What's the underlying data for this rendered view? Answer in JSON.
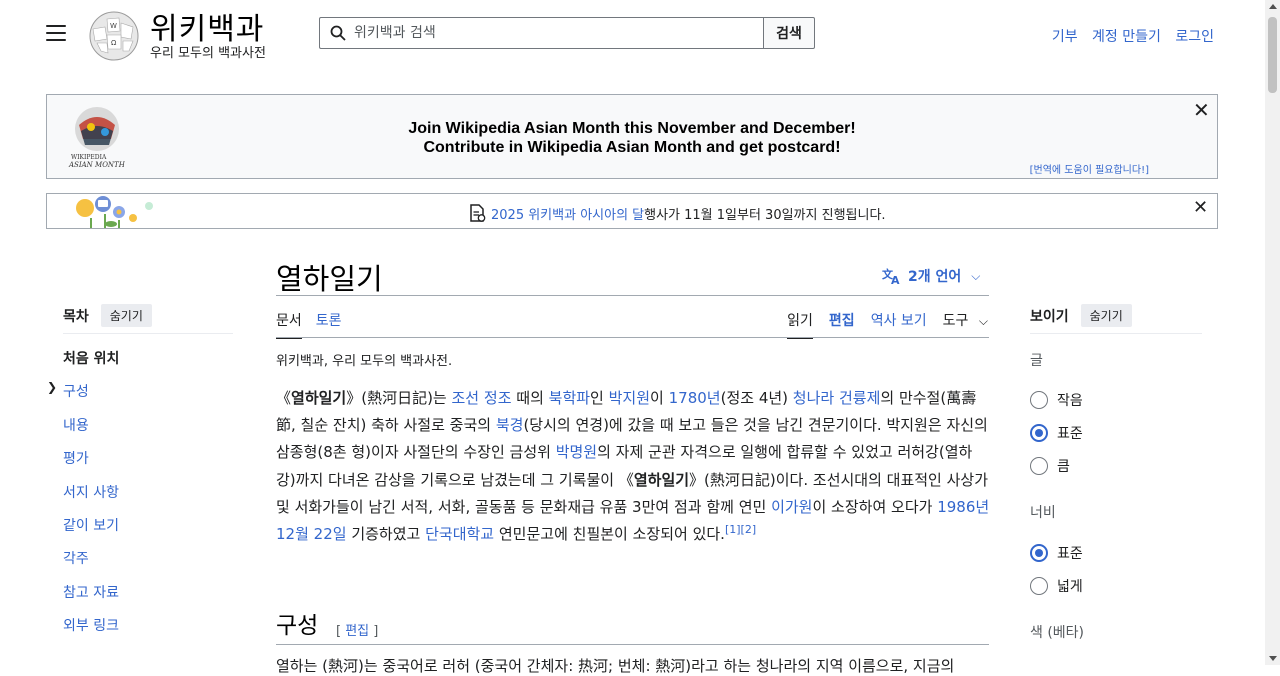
{
  "header": {
    "wordmark": "위키백과",
    "tagline": "우리 모두의 백과사전",
    "search_placeholder": "위키백과 검색",
    "search_button": "검색",
    "links": [
      "기부",
      "계정 만들기",
      "로그인"
    ]
  },
  "banner1": {
    "line1": "Join Wikipedia Asian Month this November and December!",
    "line2": "Contribute in Wikipedia Asian Month and get postcard!",
    "help": "[번역에 도움이 필요합니다!]"
  },
  "banner2": {
    "link": "2025 위키백과 아시아의 달",
    "text": " 행사가 11월 1일부터 30일까지 진행됩니다."
  },
  "toc": {
    "title": "목차",
    "hide": "숨기기",
    "items": [
      "처음 위치",
      "구성",
      "내용",
      "평가",
      "서지 사항",
      "같이 보기",
      "각주",
      "참고 자료",
      "외부 링크"
    ]
  },
  "article": {
    "title": "열하일기",
    "languages": "2개 언어",
    "tabs_left": [
      "문서",
      "토론"
    ],
    "tabs_right": [
      "읽기",
      "편집",
      "역사 보기",
      "도구"
    ],
    "sitesub": "위키백과, 우리 모두의 백과사전.",
    "section1": "구성",
    "section1_edit": "[ 편집 ]",
    "section1_start": "열하는 (熱河)는 중국어로 러허 (중국어 간체자: 热河; 번체: 熱河)라고 하는 청나라의 지역 이름으로, 지금의"
  },
  "tools": {
    "title": "보이기",
    "hide": "숨기기",
    "text_label": "글",
    "text_options": [
      "작음",
      "표준",
      "큼"
    ],
    "width_label": "너비",
    "width_options": [
      "표준",
      "넓게"
    ],
    "color_label": "색 (베타)"
  },
  "colors": {
    "link": "#3366cc",
    "text": "#202122",
    "border": "#a2a9b1"
  }
}
